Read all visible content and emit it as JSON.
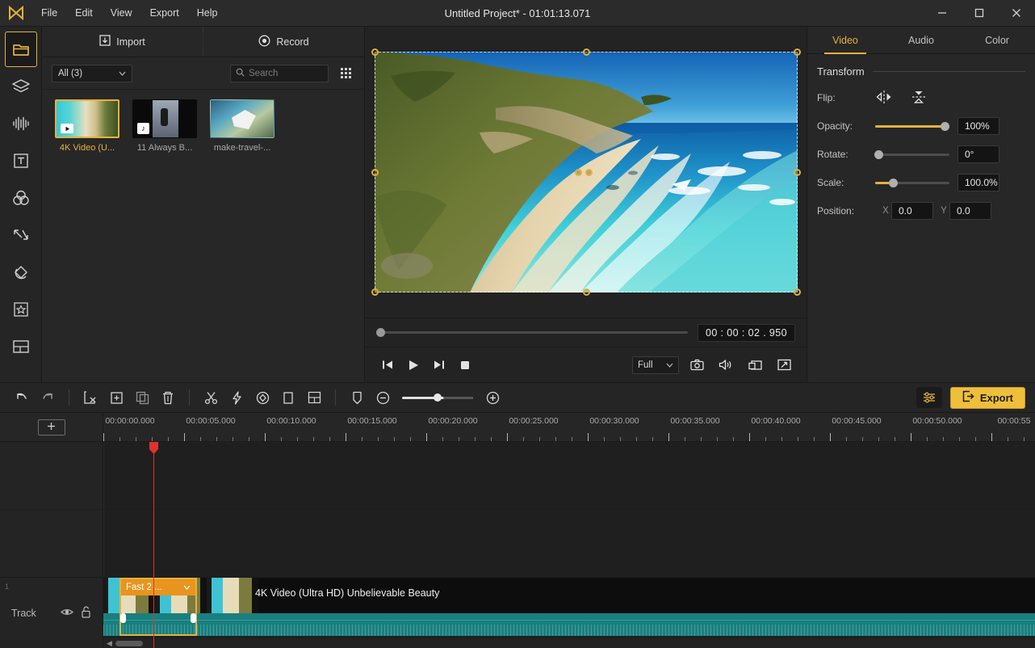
{
  "window": {
    "title": "Untitled Project* - 01:01:13.071",
    "logo_icon": "play-brand-icon",
    "minimize_icon": "minimize-icon",
    "maximize_icon": "maximize-icon",
    "close_icon": "close-icon"
  },
  "menubar": {
    "items": [
      {
        "label": "File"
      },
      {
        "label": "Edit"
      },
      {
        "label": "View"
      },
      {
        "label": "Export"
      },
      {
        "label": "Help"
      }
    ]
  },
  "rail": {
    "items": [
      {
        "name": "media-library",
        "icon": "folder-icon",
        "active": true
      },
      {
        "name": "layers",
        "icon": "layers-icon",
        "active": false
      },
      {
        "name": "audio",
        "icon": "audio-waveform-icon",
        "active": false
      },
      {
        "name": "titles",
        "icon": "text-t-icon",
        "active": false
      },
      {
        "name": "filters",
        "icon": "color-circles-icon",
        "active": false
      },
      {
        "name": "transitions",
        "icon": "transition-arrows-icon",
        "active": false
      },
      {
        "name": "effects",
        "icon": "effects-swirl-icon",
        "active": false
      },
      {
        "name": "elements",
        "icon": "star-box-icon",
        "active": false
      },
      {
        "name": "split-screen",
        "icon": "split-screen-icon",
        "active": false
      }
    ]
  },
  "media_panel": {
    "tabs": [
      {
        "label": "Import",
        "icon": "import-icon"
      },
      {
        "label": "Record",
        "icon": "record-icon"
      }
    ],
    "filter": {
      "value": "All (3)",
      "chevron": "chevron-down-icon"
    },
    "search": {
      "value": "",
      "placeholder": "Search",
      "icon": "search-icon"
    },
    "view_toggle_icon": "grid-view-icon",
    "items": [
      {
        "label": "4K Video (U...",
        "badge": "play-badge",
        "selected": true,
        "thumb": "thumb-beach"
      },
      {
        "label": "11 Always B...",
        "badge": "music-badge",
        "selected": false,
        "thumb": "thumb-dance"
      },
      {
        "label": "make-travel-...",
        "badge": "play-badge",
        "selected": false,
        "thumb": "thumb-travel"
      }
    ]
  },
  "preview": {
    "timecode": "00 : 00 : 02 . 950",
    "transport": [
      {
        "name": "prev-frame-button",
        "icon": "prev-frame-icon"
      },
      {
        "name": "play-button",
        "icon": "play-icon"
      },
      {
        "name": "next-frame-button",
        "icon": "next-frame-icon"
      },
      {
        "name": "stop-button",
        "icon": "stop-icon"
      }
    ],
    "quality": {
      "value": "Full",
      "chevron": "chevron-down-icon"
    },
    "right_controls": [
      {
        "name": "snapshot-button",
        "icon": "camera-icon"
      },
      {
        "name": "volume-button",
        "icon": "speaker-icon"
      },
      {
        "name": "pip-button",
        "icon": "pip-icon"
      },
      {
        "name": "fullscreen-button",
        "icon": "fullscreen-icon"
      }
    ]
  },
  "properties": {
    "tabs": [
      {
        "label": "Video",
        "active": true
      },
      {
        "label": "Audio",
        "active": false
      },
      {
        "label": "Color",
        "active": false
      }
    ],
    "section_title": "Transform",
    "flip": {
      "label": "Flip:",
      "horizontal_icon": "flip-horizontal-icon",
      "vertical_icon": "flip-vertical-icon"
    },
    "opacity": {
      "label": "Opacity:",
      "value": "100%",
      "percent": 100
    },
    "rotate": {
      "label": "Rotate:",
      "value": "0°",
      "percent": 0
    },
    "scale": {
      "label": "Scale:",
      "value": "100.0%",
      "percent": 22
    },
    "position": {
      "label": "Position:",
      "x_label": "X",
      "x_value": "0.0",
      "y_label": "Y",
      "y_value": "0.0"
    }
  },
  "toolbar": {
    "left_tools": [
      {
        "name": "undo-button",
        "icon": "undo-icon"
      },
      {
        "name": "redo-button",
        "icon": "redo-icon"
      }
    ],
    "edit_tools": [
      {
        "name": "crop-cut-button",
        "icon": "crop-cut-icon"
      },
      {
        "name": "add-clip-button",
        "icon": "add-clip-icon"
      },
      {
        "name": "duplicate-button",
        "icon": "duplicate-icon"
      },
      {
        "name": "delete-button",
        "icon": "trash-icon"
      }
    ],
    "clip_tools": [
      {
        "name": "split-button",
        "icon": "scissors-icon"
      },
      {
        "name": "speed-button",
        "icon": "lightning-icon"
      },
      {
        "name": "keyframe-button",
        "icon": "keyframe-diamond-icon"
      },
      {
        "name": "crop-button",
        "icon": "crop-square-icon"
      },
      {
        "name": "mosaic-button",
        "icon": "mosaic-grid-icon"
      }
    ],
    "zoom_tools": [
      {
        "name": "marker-button",
        "icon": "marker-icon"
      },
      {
        "name": "zoom-out-button",
        "icon": "zoom-out-icon"
      },
      {
        "name": "zoom-in-button",
        "icon": "zoom-in-icon"
      }
    ],
    "settings_icon": "settings-sliders-icon",
    "export_label": "Export",
    "export_icon": "export-arrow-icon"
  },
  "timeline": {
    "add_track_label": "+",
    "add_track_icon": "plus-icon",
    "ticks": [
      "00:00:00.000",
      "00:00:05.000",
      "00:00:10.000",
      "00:00:15.000",
      "00:00:20.000",
      "00:00:25.000",
      "00:00:30.000",
      "00:00:35.000",
      "00:00:40.000",
      "00:00:45.000",
      "00:00:50.000",
      "00:00:55"
    ],
    "track": {
      "label": "Track",
      "visibility_icon": "eye-icon",
      "lock_icon": "unlock-icon"
    },
    "clip": {
      "title": "4K Video (Ultra HD) Unbelievable Beauty",
      "speed_badge": "Fast 2 ...",
      "speed_chevron": "chevron-down-icon"
    },
    "scroll": {
      "left_arrow_icon": "scroll-left-icon"
    }
  },
  "colors": {
    "accent": "#e3b23c",
    "export": "#efbf3b",
    "playhead": "#e03131",
    "audio_track": "#18807f",
    "speed_badge": "#e8941e"
  }
}
